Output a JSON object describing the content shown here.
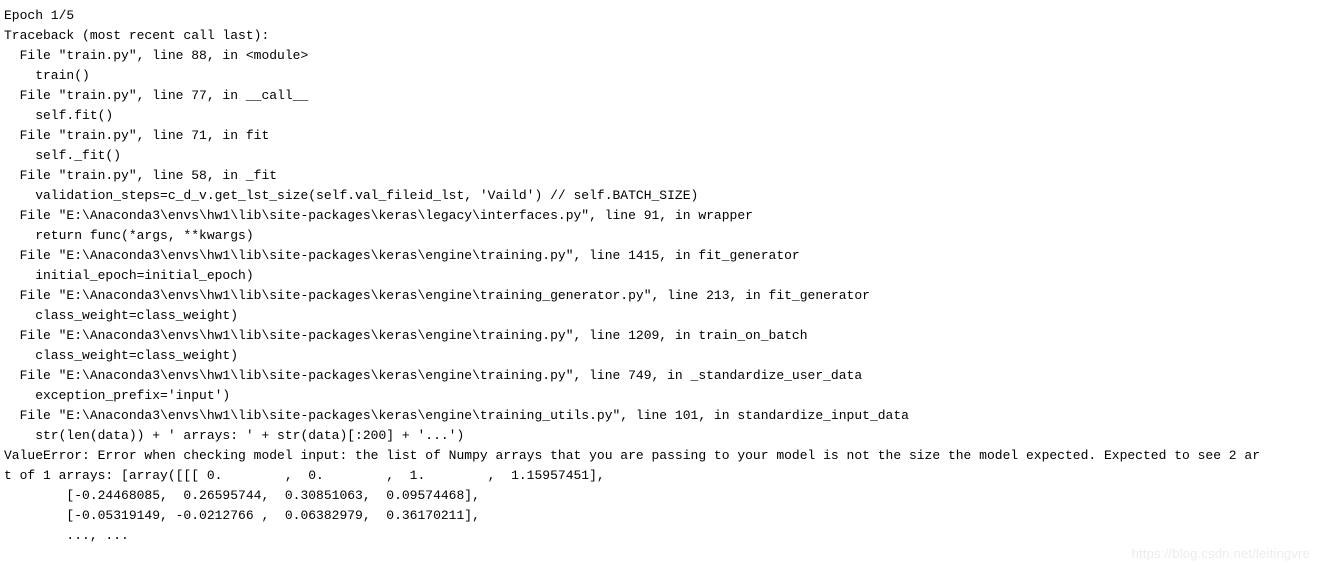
{
  "lines": [
    "Epoch 1/5",
    "Traceback (most recent call last):",
    "  File \"train.py\", line 88, in <module>",
    "    train()",
    "  File \"train.py\", line 77, in __call__",
    "    self.fit()",
    "  File \"train.py\", line 71, in fit",
    "    self._fit()",
    "  File \"train.py\", line 58, in _fit",
    "    validation_steps=c_d_v.get_lst_size(self.val_fileid_lst, 'Vaild') // self.BATCH_SIZE)",
    "  File \"E:\\Anaconda3\\envs\\hw1\\lib\\site-packages\\keras\\legacy\\interfaces.py\", line 91, in wrapper",
    "    return func(*args, **kwargs)",
    "  File \"E:\\Anaconda3\\envs\\hw1\\lib\\site-packages\\keras\\engine\\training.py\", line 1415, in fit_generator",
    "    initial_epoch=initial_epoch)",
    "  File \"E:\\Anaconda3\\envs\\hw1\\lib\\site-packages\\keras\\engine\\training_generator.py\", line 213, in fit_generator",
    "    class_weight=class_weight)",
    "  File \"E:\\Anaconda3\\envs\\hw1\\lib\\site-packages\\keras\\engine\\training.py\", line 1209, in train_on_batch",
    "    class_weight=class_weight)",
    "  File \"E:\\Anaconda3\\envs\\hw1\\lib\\site-packages\\keras\\engine\\training.py\", line 749, in _standardize_user_data",
    "    exception_prefix='input')",
    "  File \"E:\\Anaconda3\\envs\\hw1\\lib\\site-packages\\keras\\engine\\training_utils.py\", line 101, in standardize_input_data",
    "    str(len(data)) + ' arrays: ' + str(data)[:200] + '...')",
    "ValueError: Error when checking model input: the list of Numpy arrays that you are passing to your model is not the size the model expected. Expected to see 2 ar",
    "t of 1 arrays: [array([[[ 0.        ,  0.        ,  1.        ,  1.15957451],",
    "        [-0.24468085,  0.26595744,  0.30851063,  0.09574468],",
    "        [-0.05319149, -0.0212766 ,  0.06382979,  0.36170211],",
    "        ..., ..."
  ],
  "watermark": "https://blog.csdn.net/leitingvre"
}
